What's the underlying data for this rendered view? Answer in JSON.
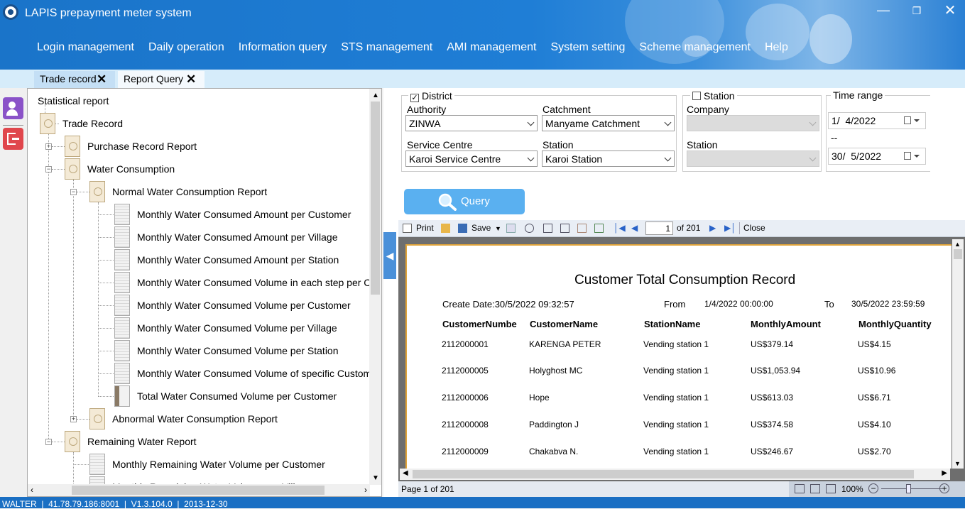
{
  "app": {
    "title": "LAPIS prepayment meter system"
  },
  "menu": [
    "Login management",
    "Daily operation",
    "Information query",
    "STS management",
    "AMI management",
    "System setting",
    "Scheme management",
    "Help"
  ],
  "tabs": [
    {
      "label": "Trade record"
    },
    {
      "label": "Report Query"
    }
  ],
  "tree": {
    "root": "Statistical report",
    "trade_record": "Trade Record",
    "purchase": "Purchase Record Report",
    "water_consumption": "Water Consumption",
    "normal": "Normal Water Consumption Report",
    "normal_items": [
      "Monthly Water Consumed Amount per Customer",
      "Monthly Water Consumed Amount per Village",
      "Monthly Water Consumed Amount per Station",
      "Monthly Water Consumed Volume in each step per Customer",
      "Monthly Water Consumed Volume per Customer",
      "Monthly Water Consumed Volume per Village",
      "Monthly Water Consumed Volume per Station",
      "Monthly Water Consumed Volume of specific Customer",
      "Total Water Consumed Volume per Customer"
    ],
    "abnormal": "Abnormal Water Consumption Report",
    "remaining": "Remaining Water Report",
    "remaining_items": [
      "Monthly Remaining Water Volume per Customer",
      "Monthly Remaining Water Volume per Village"
    ]
  },
  "filters": {
    "district_label": "District",
    "district_checked": true,
    "authority_label": "Authority",
    "authority": "ZINWA",
    "catchment_label": "Catchment",
    "catchment": "Manyame Catchment",
    "service_centre_label": "Service Centre",
    "service_centre": "Karoi Service Centre",
    "station_label": "Station",
    "station": "Karoi Station",
    "station_group_label": "Station",
    "station_group_checked": false,
    "company_label": "Company",
    "company": "",
    "station2_label": "Station",
    "station2": "",
    "time_range_label": "Time range",
    "date_from": "1/  4/2022",
    "date_sep": "--",
    "date_to": "30/  5/2022"
  },
  "query_label": "Query",
  "report_toolbar": {
    "print": "Print",
    "save": "Save",
    "page": "1",
    "of": "of 201",
    "close": "Close"
  },
  "report": {
    "title": "Customer Total Consumption Record",
    "create_date": "Create Date:30/5/2022 09:32:57",
    "from_label": "From",
    "from": "1/4/2022 00:00:00",
    "to_label": "To",
    "to": "30/5/2022 23:59:59",
    "columns": [
      "CustomerNumbe",
      "CustomerName",
      "StationName",
      "MonthlyAmount",
      "MonthlyQuantity"
    ],
    "rows": [
      [
        "2112000001",
        "KARENGA PETER",
        "Vending station 1",
        "US$379.14",
        "US$4.15"
      ],
      [
        "2112000005",
        "Holyghost MC",
        "Vending station 1",
        "US$1,053.94",
        "US$10.96"
      ],
      [
        "2112000006",
        "Hope",
        "Vending station 1",
        "US$613.03",
        "US$6.71"
      ],
      [
        "2112000008",
        "Paddington J",
        "Vending station 1",
        "US$374.58",
        "US$4.10"
      ],
      [
        "2112000009",
        "Chakabva N.",
        "Vending station 1",
        "US$246.67",
        "US$2.70"
      ]
    ]
  },
  "report_status": {
    "page": "Page 1 of 201",
    "zoom": "100%"
  },
  "statusbar": "WALTER  |  41.78.79.186:8001  |  V1.3.104.0  |  2013-12-30"
}
